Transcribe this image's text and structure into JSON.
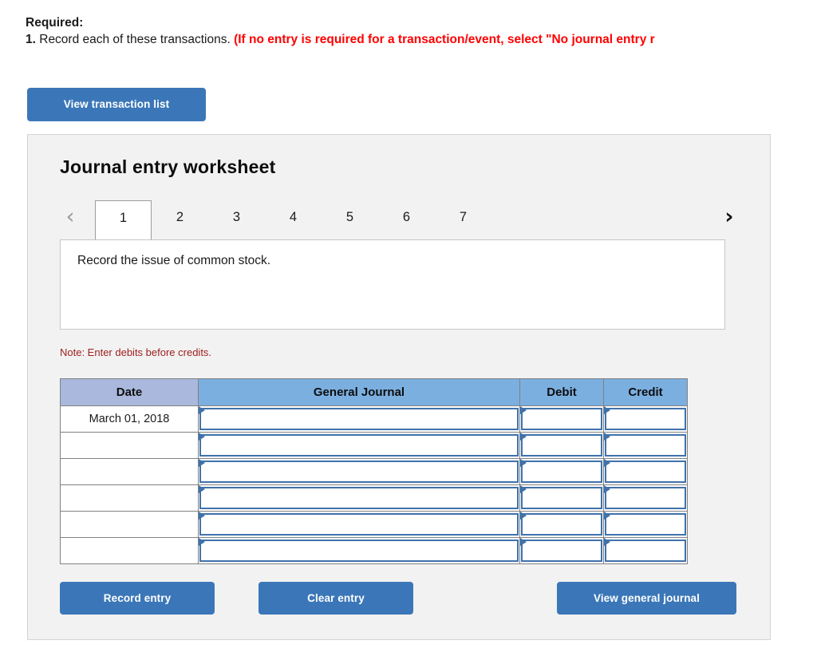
{
  "required": {
    "label": "Required:",
    "item_number": "1.",
    "item_text": " Record each of these transactions. ",
    "item_red": "(If no entry is required for a transaction/event, select \"No journal entry r"
  },
  "toolbar": {
    "view_transaction_list": "View transaction list"
  },
  "worksheet": {
    "title": "Journal entry worksheet",
    "prev_arrow": "‹",
    "next_arrow": "›",
    "tabs": [
      {
        "label": "1",
        "active": true
      },
      {
        "label": "2",
        "active": false
      },
      {
        "label": "3",
        "active": false
      },
      {
        "label": "4",
        "active": false
      },
      {
        "label": "5",
        "active": false
      },
      {
        "label": "6",
        "active": false
      },
      {
        "label": "7",
        "active": false
      }
    ],
    "description": "Record the issue of common stock.",
    "note": "Note: Enter debits before credits.",
    "table": {
      "headers": [
        "Date",
        "General Journal",
        "Debit",
        "Credit"
      ],
      "rows": [
        {
          "date": "March 01, 2018",
          "general_journal": "",
          "debit": "",
          "credit": ""
        },
        {
          "date": "",
          "general_journal": "",
          "debit": "",
          "credit": ""
        },
        {
          "date": "",
          "general_journal": "",
          "debit": "",
          "credit": ""
        },
        {
          "date": "",
          "general_journal": "",
          "debit": "",
          "credit": ""
        },
        {
          "date": "",
          "general_journal": "",
          "debit": "",
          "credit": ""
        },
        {
          "date": "",
          "general_journal": "",
          "debit": "",
          "credit": ""
        }
      ]
    },
    "actions": {
      "record_entry": "Record entry",
      "clear_entry": "Clear entry",
      "view_general_journal": "View general journal"
    }
  },
  "colors": {
    "button_blue": "#3b77b8",
    "header_date_blue": "#a9b8dc",
    "header_blue": "#7bafe0",
    "field_border_blue": "#3f72ab",
    "red_alert": "#ff0000",
    "note_red": "#9e2020",
    "panel_bg": "#f2f2f2"
  }
}
